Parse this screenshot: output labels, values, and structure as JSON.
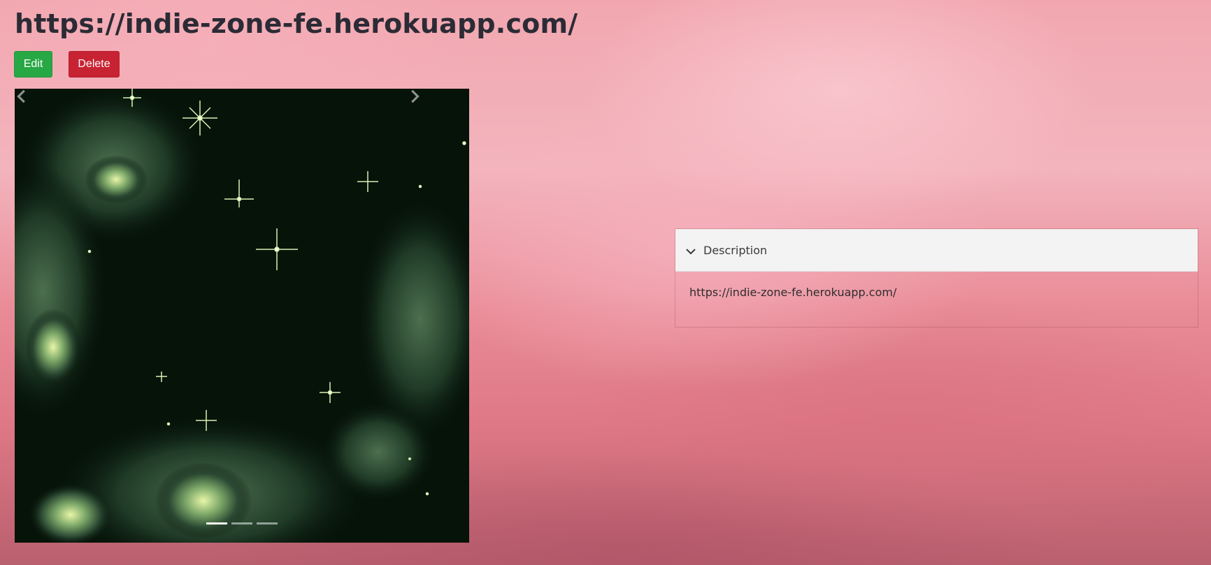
{
  "page": {
    "title": "https://indie-zone-fe.herokuapp.com/"
  },
  "actions": {
    "edit_label": "Edit",
    "delete_label": "Delete",
    "edit_color": "#28a745",
    "delete_color": "#c82333"
  },
  "carousel": {
    "prev_icon": "chevron-left-icon",
    "next_icon": "chevron-right-icon",
    "slide_count": 3,
    "active_index": 0
  },
  "description": {
    "header_label": "Description",
    "toggle_icon": "chevron-down-icon",
    "text": "https://indie-zone-fe.herokuapp.com/"
  }
}
